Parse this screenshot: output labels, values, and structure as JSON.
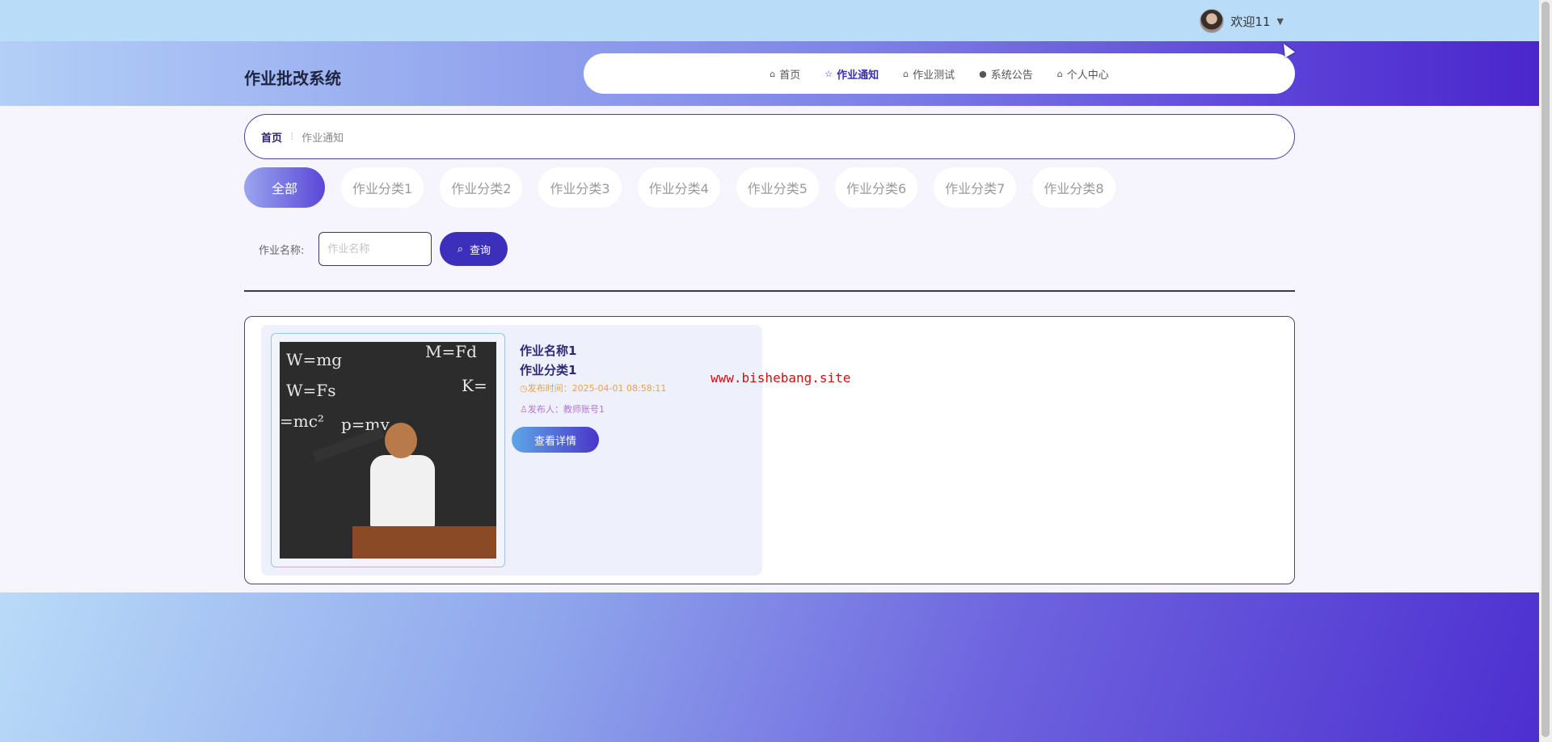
{
  "user": {
    "welcome": "欢迎11",
    "caret": "▼"
  },
  "header": {
    "logo": "作业批改系统"
  },
  "nav": [
    {
      "icon": "⌂",
      "icon_name": "home-icon",
      "label": "首页",
      "active": false
    },
    {
      "icon": "☆",
      "icon_name": "star-icon",
      "label": "作业通知",
      "active": true
    },
    {
      "icon": "⌂",
      "icon_name": "bag-icon",
      "label": "作业测试",
      "active": false
    },
    {
      "icon": "●",
      "icon_name": "info-icon",
      "label": "系统公告",
      "active": false
    },
    {
      "icon": "⌂",
      "icon_name": "user-home-icon",
      "label": "个人中心",
      "active": false
    }
  ],
  "breadcrumb": {
    "home": "首页",
    "separator": "⁝",
    "current": "作业通知"
  },
  "categories": [
    "全部",
    "作业分类1",
    "作业分类2",
    "作业分类3",
    "作业分类4",
    "作业分类5",
    "作业分类6",
    "作业分类7",
    "作业分类8"
  ],
  "search": {
    "label": "作业名称:",
    "placeholder": "作业名称",
    "value": "",
    "button": "查询",
    "button_icon": "⌕"
  },
  "cards": [
    {
      "title": "作业名称1",
      "category": "作业分类1",
      "time": "◷发布时间：2025-04-01 08:58:11",
      "author": "♙发布人：教师账号1",
      "button": "查看详情",
      "board_text": [
        "W=mg",
        "W=Fs",
        "=mc²",
        "p=mv",
        "M=Fd",
        "K="
      ]
    }
  ],
  "watermark": "www.bishebang.site",
  "colors": {
    "accent": "#3c2fbc",
    "time": "#e8a24a",
    "author": "#b574d8"
  }
}
